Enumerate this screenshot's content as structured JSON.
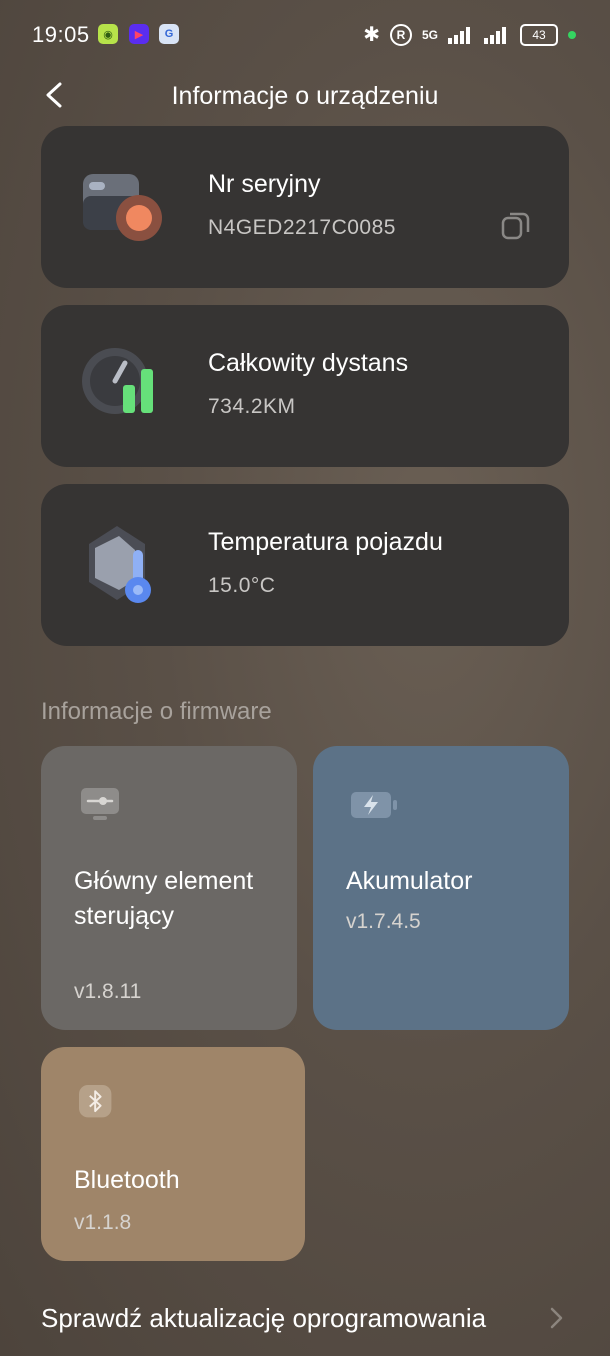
{
  "status_bar": {
    "time": "19:05",
    "network": "5G",
    "battery": "43"
  },
  "header": {
    "title": "Informacje o urządzeniu"
  },
  "cards": [
    {
      "label": "Nr seryjny",
      "value": "N4GED2217C0085",
      "icon": "serial-icon"
    },
    {
      "label": "Całkowity dystans",
      "value": "734.2KM",
      "icon": "speedometer-icon"
    },
    {
      "label": "Temperatura pojazdu",
      "value": "15.0°C",
      "icon": "temperature-icon"
    }
  ],
  "firmware": {
    "section_title": "Informacje o firmware",
    "items": [
      {
        "name": "Główny element sterujący",
        "version": "v1.8.11",
        "color": "#6b6865"
      },
      {
        "name": "Akumulator",
        "version": "v1.7.4.5",
        "color": "#5c7287"
      },
      {
        "name": "Bluetooth",
        "version": "v1.1.8",
        "color": "#9f8569"
      }
    ]
  },
  "update": {
    "label": "Sprawdź aktualizację oprogramowania"
  }
}
